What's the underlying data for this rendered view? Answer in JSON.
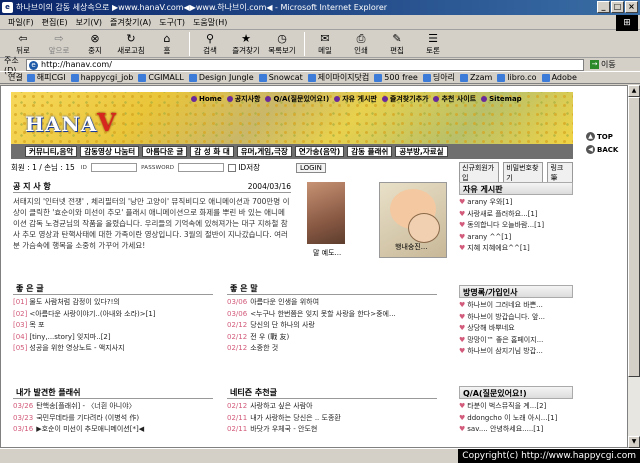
{
  "window": {
    "title": "하나브이의 감동 세상속으로 ▶www.hanaV.com◀▶www.하나브이.com◀ - Microsoft Internet Explorer",
    "icon_label": "e",
    "buttons": {
      "min": "_",
      "max": "□",
      "close": "×"
    }
  },
  "menu": [
    "파일(F)",
    "편집(E)",
    "보기(V)",
    "즐겨찾기(A)",
    "도구(T)",
    "도움말(H)"
  ],
  "toolbar": [
    {
      "label": "뒤로",
      "icon": "back-arrow-icon",
      "glyph": "⇦",
      "enabled": true
    },
    {
      "label": "앞으로",
      "icon": "forward-arrow-icon",
      "glyph": "⇨",
      "enabled": false
    },
    {
      "label": "중지",
      "icon": "stop-icon",
      "glyph": "⊗",
      "enabled": true
    },
    {
      "label": "새로고침",
      "icon": "refresh-icon",
      "glyph": "↻",
      "enabled": true
    },
    {
      "label": "홈",
      "icon": "home-icon",
      "glyph": "⌂",
      "enabled": true
    },
    {
      "label": "검색",
      "icon": "search-icon",
      "glyph": "⚲",
      "enabled": true
    },
    {
      "label": "즐겨찾기",
      "icon": "favorites-icon",
      "glyph": "★",
      "enabled": true
    },
    {
      "label": "목록보기",
      "icon": "history-icon",
      "glyph": "◷",
      "enabled": true
    },
    {
      "label": "메일",
      "icon": "mail-icon",
      "glyph": "✉",
      "enabled": true
    },
    {
      "label": "인쇄",
      "icon": "print-icon",
      "glyph": "⎙",
      "enabled": true
    },
    {
      "label": "편집",
      "icon": "edit-icon",
      "glyph": "✎",
      "enabled": true
    },
    {
      "label": "토론",
      "icon": "discuss-icon",
      "glyph": "☰",
      "enabled": true
    }
  ],
  "address": {
    "label": "주소(D)",
    "value": "http://hanav.com/",
    "go_label": "이동"
  },
  "links": {
    "label": "연결",
    "items": [
      "해피CGI",
      "happycgi_job",
      "CGIMALL",
      "Design Jungle",
      "Snowcat",
      "제이마이지닷컴",
      "500 free",
      "딩아리",
      "Zzam",
      "libro.co",
      "Adobe"
    ]
  },
  "site": {
    "logo_text": "HANA",
    "logo_v": "V",
    "top_nav": [
      "Home",
      "공지사항",
      "Q/A(질문있어요!)",
      "자유 게시판",
      "즐겨찾기추가",
      "추천 사이트",
      "Sitemap"
    ],
    "nav": [
      "커뮤니티,음악",
      "감동영상 나눔터",
      "아름다운 글",
      "감 성 화 대",
      "유머,게임,극장",
      "연가송(음악)",
      "감동 플래쉬",
      "공부방,자료실"
    ],
    "login": {
      "status": "회원 : 1 / 손님 : 15",
      "id_label": "ID",
      "pw_label": "PASSWORD",
      "save_label": "ID저장",
      "login_btn": "LOGIN",
      "join_btn": "신규회원가입",
      "find_btn": "비밀번호찾기",
      "link_btn": "링크 筆"
    },
    "notice": {
      "title": "공 지 사 항",
      "date": "2004/03/16",
      "body": "서태지의 '인터넷 전쟁' , 체리필터의 '낭만 고양이' 뮤직비디오 애니메이션과 700만명 이상이 클릭한 '효순이와 미선이 추모' 플래시 애니메이션으로 화제를 뿌린 바 있는 애니메이션 감독 노경균님의 작품을 올렸습니다. 우리들의 기억속에 있혀져가는 대구 지하철 참사 추모 영상과 탄핵사태에 대한 가족이란 영상입니다. 3월의 절반이 지나갔습니다. 여러분 가슴속에 행복을 소중히 가꾸어 가세요!"
    },
    "photos": {
      "cap1": "말 예도...",
      "cap2": "행내숭진..."
    },
    "right_btns": {
      "top": "TOP",
      "back": "BACK"
    },
    "best": {
      "title": "좋 은 글",
      "rows": [
        {
          "n": "[01]",
          "t": "물도 사람처럼 감정이 있다?!의"
        },
        {
          "n": "[02]",
          "t": "<아름다운 사랑이야기..(아내와 소라)>[1]"
        },
        {
          "n": "[03]",
          "t": "목 포"
        },
        {
          "n": "[04]",
          "t": "[tiny,...story] 잊지마..[2]"
        },
        {
          "n": "[05]",
          "t": "성공을 위한 영상노트 - 액지사지"
        }
      ]
    },
    "good": {
      "title": "좋 은 말",
      "rows": [
        {
          "d": "03/06",
          "t": "아름다운 인생을 위하여"
        },
        {
          "d": "03/06",
          "t": "<누구나 한번쯤은 잊지 못할 사랑을 한다>중에..."
        },
        {
          "d": "02/12",
          "t": "당신의 단 하나의 사랑"
        },
        {
          "d": "02/12",
          "t": "전 우 (戰 友)"
        },
        {
          "d": "02/12",
          "t": "소중한 것"
        }
      ]
    },
    "my": {
      "title": "내가 발견한 플래쉬",
      "rows": [
        {
          "d": "03/26",
          "t": "탄핵송[플래쉬] - 〈너흰 아니야〉"
        },
        {
          "d": "03/23",
          "t": "국민무데타를 기다려라 (이병석 作)"
        },
        {
          "d": "03/16",
          "t": "▶호순이 미선이 추모애니메이션[*]◀"
        }
      ]
    },
    "net": {
      "title": "네티즌 추천글",
      "rows": [
        {
          "d": "02/12",
          "t": "사랑하고 싶은 사람아"
        },
        {
          "d": "02/11",
          "t": "내가 사랑하는 당신은 .. 도종환"
        },
        {
          "d": "02/11",
          "t": "바닷가 우체국 - 안도현"
        }
      ]
    },
    "free": {
      "title": "자유 게시판",
      "rows": [
        {
          "n": "♥",
          "t": "arany 우와[1]"
        },
        {
          "n": "♥",
          "t": "사랑새로 플러하요...[1]"
        },
        {
          "n": "♥",
          "t": "동의합니다 오늘바람...[1]"
        },
        {
          "n": "♥",
          "t": "arany ^^[1]"
        },
        {
          "n": "♥",
          "t": "지혜 지혜에요^^[1]"
        }
      ]
    },
    "guest": {
      "title": "방명록/가입인사",
      "rows": [
        {
          "n": "♥",
          "t": "하나브이 그러네요 바쁜..."
        },
        {
          "n": "♥",
          "t": "하나브이 방갑습니다. 앞..."
        },
        {
          "n": "♥",
          "t": "상당해 바뿌네요"
        },
        {
          "n": "♥",
          "t": "망망이™ 좋은 홈페이지..."
        },
        {
          "n": "♥",
          "t": "하나브이 삼지기님 방갑..."
        }
      ]
    },
    "qa": {
      "title": "Q/A(질문있어요!)",
      "rows": [
        {
          "n": "♥",
          "t": "타분이 벅스뮤직을 계...[2]"
        },
        {
          "n": "♥",
          "t": "ddongcho 이 노래 아시...[1]"
        },
        {
          "n": "♥",
          "t": "sav.... 안녕하세요.....[1]"
        }
      ]
    }
  },
  "status": {
    "copyright": "Copyright(c) http://www.happycgi.com"
  }
}
